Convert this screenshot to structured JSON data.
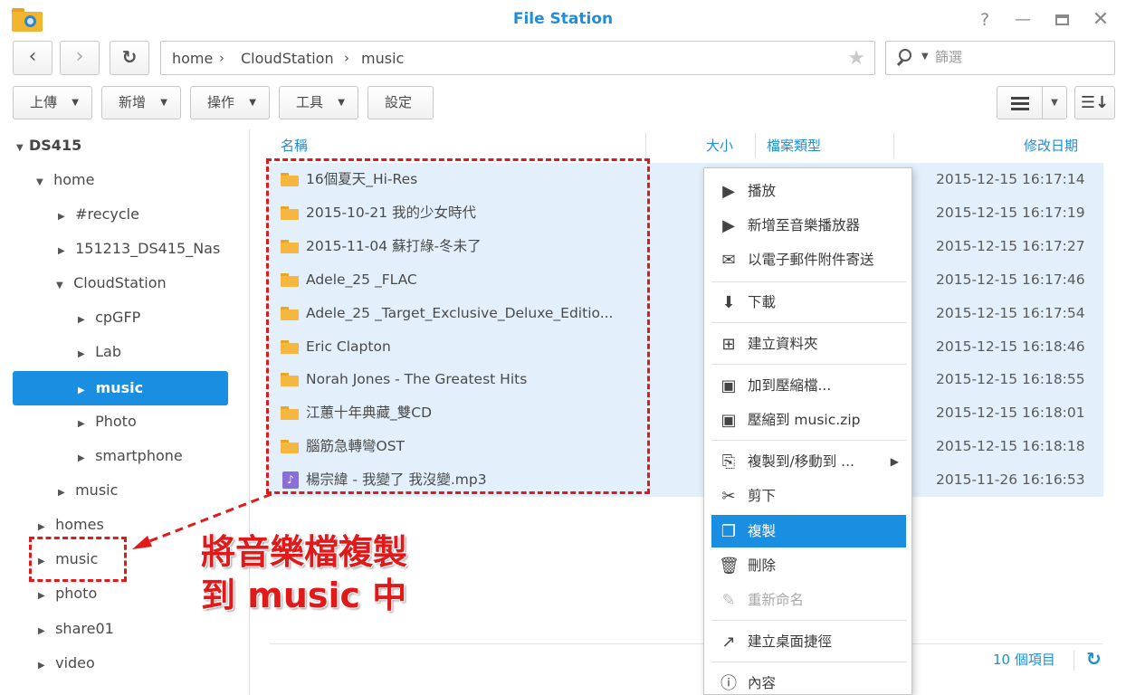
{
  "window": {
    "title": "File Station"
  },
  "toolbar1": {
    "back_icon": "‹",
    "forward_icon": "›",
    "refresh_icon": "↻",
    "breadcrumb": [
      "home",
      "CloudStation",
      "music"
    ],
    "star_icon": "★",
    "search_placeholder": "篩選"
  },
  "toolbar2": {
    "upload": "上傳",
    "create": "新增",
    "action": "操作",
    "tools": "工具",
    "settings": "設定"
  },
  "tree": {
    "root": "DS415",
    "home": "home",
    "recycle": "#recycle",
    "nas": "151213_DS415_Nas",
    "cloudstation": "CloudStation",
    "cpgfp": "cpGFP",
    "lab": "Lab",
    "music_selected": "music",
    "photo_sub": "Photo",
    "smartphone": "smartphone",
    "music_home": "music",
    "homes": "homes",
    "music_share": "music",
    "photo": "photo",
    "share01": "share01",
    "video": "video"
  },
  "columns": {
    "name": "名稱",
    "size": "大小",
    "type": "檔案類型",
    "modified": "修改日期"
  },
  "files": [
    {
      "name": "16個夏天_Hi-Res",
      "date": "2015-12-15 16:17:14",
      "kind": "folder"
    },
    {
      "name": "2015-10-21 我的少女時代",
      "date": "2015-12-15 16:17:19",
      "kind": "folder"
    },
    {
      "name": "2015-11-04 蘇打綠-冬未了",
      "date": "2015-12-15 16:17:27",
      "kind": "folder"
    },
    {
      "name": "Adele_25 _FLAC",
      "date": "2015-12-15 16:17:46",
      "kind": "folder"
    },
    {
      "name": "Adele_25 _Target_Exclusive_Deluxe_Editio...",
      "date": "2015-12-15 16:17:54",
      "kind": "folder"
    },
    {
      "name": "Eric Clapton",
      "date": "2015-12-15 16:18:46",
      "kind": "folder"
    },
    {
      "name": "Norah Jones - The Greatest Hits",
      "date": "2015-12-15 16:18:55",
      "kind": "folder"
    },
    {
      "name": "江蕙十年典藏_雙CD",
      "date": "2015-12-15 16:18:01",
      "kind": "folder"
    },
    {
      "name": "腦筋急轉彎OST",
      "date": "2015-12-15 16:18:18",
      "kind": "folder"
    },
    {
      "name": "楊宗緯 - 我變了 我沒變.mp3",
      "date": "2015-11-26 16:16:53",
      "kind": "audio"
    }
  ],
  "status": {
    "item_count": "10 個項目"
  },
  "context_menu": {
    "play": "播放",
    "add_to_player": "新增至音樂播放器",
    "email_attach": "以電子郵件附件寄送",
    "download": "下載",
    "create_folder": "建立資料夾",
    "add_archive": "加到壓縮檔...",
    "compress_to": "壓縮到 music.zip",
    "copy_move_to": "複製到/移動到 ...",
    "cut": "剪下",
    "copy": "複製",
    "delete": "刪除",
    "rename": "重新命名",
    "shortcut": "建立桌面捷徑",
    "properties": "內容"
  },
  "annotation": {
    "line1": "將音樂檔複製",
    "line2": "到 music 中"
  },
  "colors": {
    "accent": "#1a8ee1",
    "selection_row": "#e3f0fb",
    "annotation_red": "#e01a1a",
    "folder": "#f5b740"
  }
}
